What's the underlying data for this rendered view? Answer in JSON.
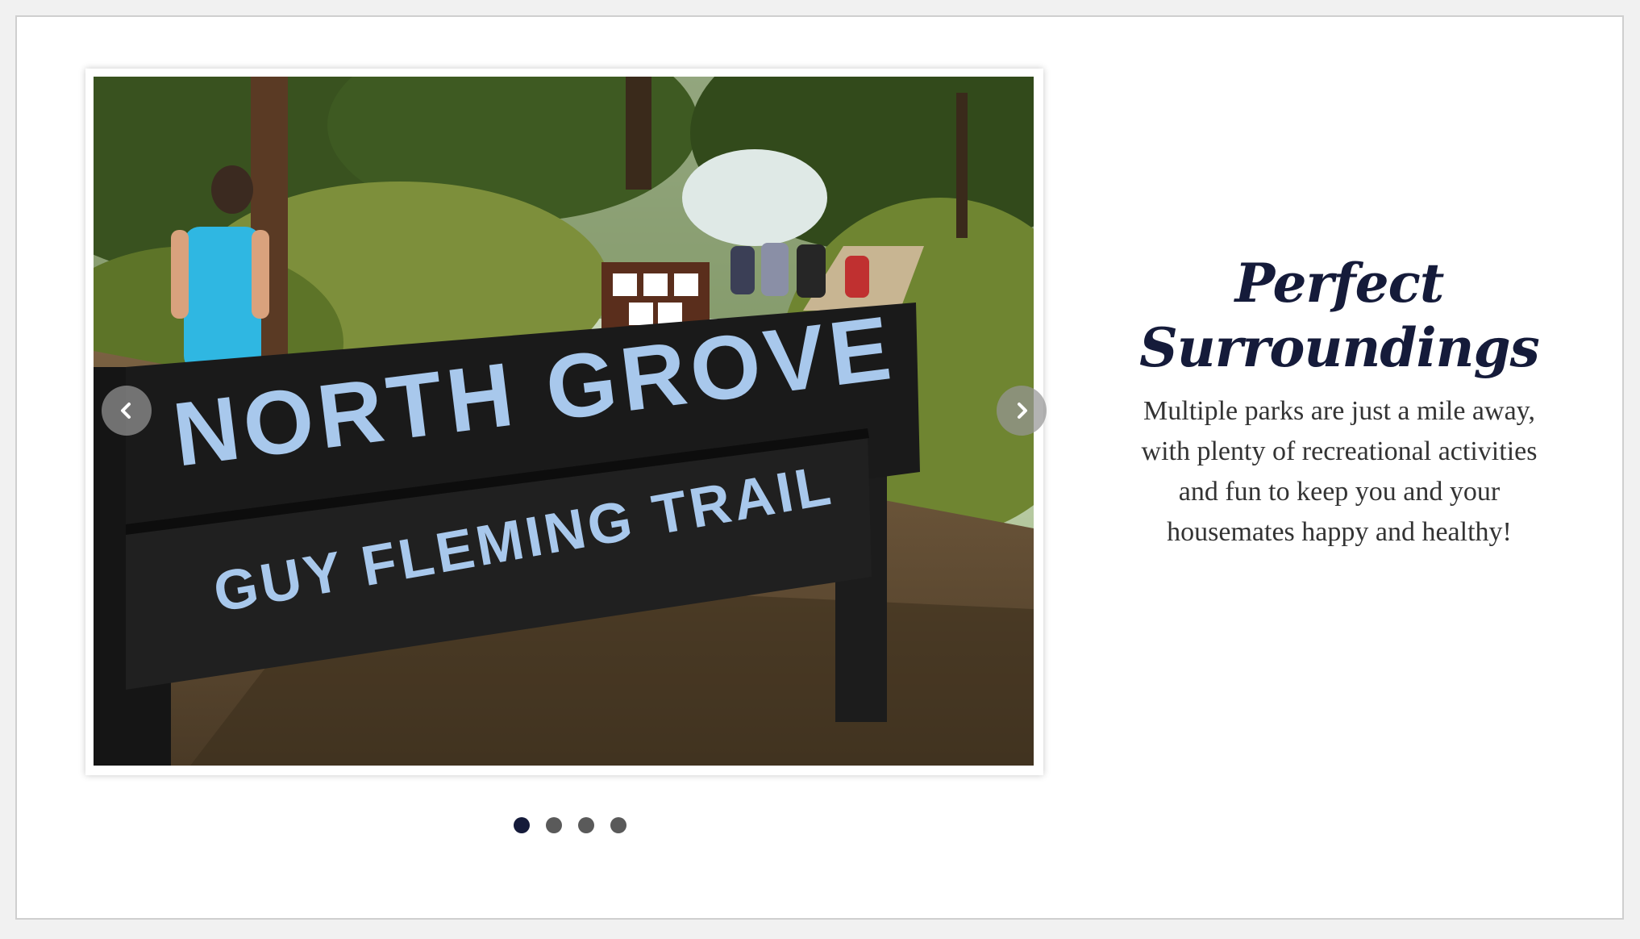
{
  "slider": {
    "sign_line_1": "NORTH GROVE",
    "sign_line_2": "GUY FLEMING TRAIL",
    "prev_icon": "chevron-left-icon",
    "next_icon": "chevron-right-icon",
    "slide_count": 4,
    "active_slide": 1
  },
  "feature": {
    "heading_line_1": "Perfect",
    "heading_line_2": "Surroundings",
    "body_lines": [
      "Multiple parks are just a mile away,",
      "with plenty of recreational activities",
      "and fun to keep you and your",
      "housemates happy and healthy!"
    ]
  },
  "colors": {
    "heading": "#151b3a",
    "active_dot": "#151b3a",
    "inactive_dot": "#5a5a5a",
    "sign_letters": "#a8c8ec"
  }
}
